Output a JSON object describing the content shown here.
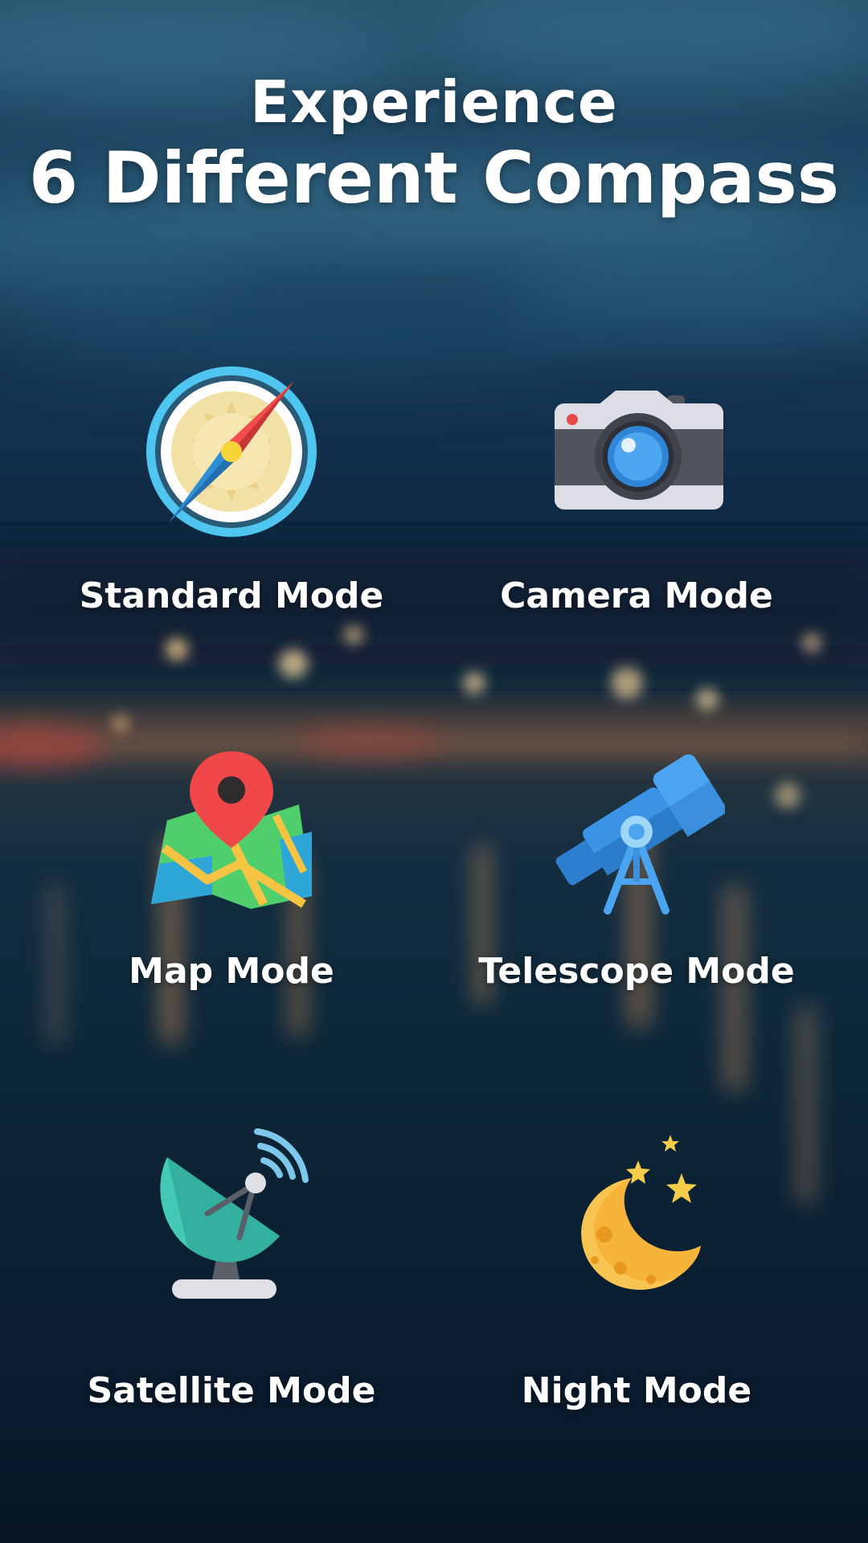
{
  "headline": {
    "line1": "Experience",
    "line2": "6 Different Compass"
  },
  "modes": [
    {
      "label": "Standard Mode",
      "icon": "compass-icon"
    },
    {
      "label": "Camera Mode",
      "icon": "camera-icon"
    },
    {
      "label": "Map Mode",
      "icon": "map-pin-icon"
    },
    {
      "label": "Telescope Mode",
      "icon": "telescope-icon"
    },
    {
      "label": "Satellite Mode",
      "icon": "satellite-dish-icon"
    },
    {
      "label": "Night Mode",
      "icon": "moon-stars-icon"
    }
  ],
  "colors": {
    "background_top": "#26506a",
    "background_bottom": "#081626",
    "text": "#ffffff"
  }
}
